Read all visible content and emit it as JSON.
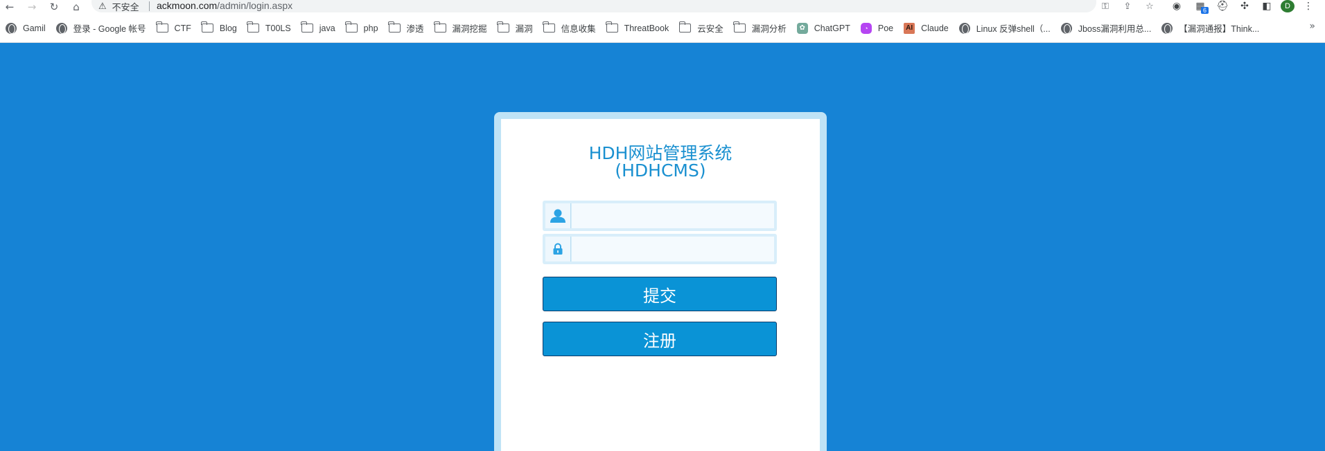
{
  "browser": {
    "security_label": "不安全",
    "url_host": "ackmoon.com",
    "url_path": "/admin/login.aspx",
    "extension_badge": "6",
    "profile_initial": "D",
    "icons": [
      "back-icon",
      "forward-icon",
      "reload-icon",
      "home-icon",
      "warning-icon",
      "key-icon",
      "share-icon",
      "star-icon"
    ]
  },
  "bookmarks": [
    {
      "label": "Gamil",
      "icon": "globe"
    },
    {
      "label": "登录 - Google 帐号",
      "icon": "globe"
    },
    {
      "label": "CTF",
      "icon": "folder"
    },
    {
      "label": "Blog",
      "icon": "folder"
    },
    {
      "label": "T00LS",
      "icon": "folder"
    },
    {
      "label": "java",
      "icon": "folder"
    },
    {
      "label": "php",
      "icon": "folder"
    },
    {
      "label": "渗透",
      "icon": "folder"
    },
    {
      "label": "漏洞挖掘",
      "icon": "folder"
    },
    {
      "label": "漏洞",
      "icon": "folder"
    },
    {
      "label": "信息收集",
      "icon": "folder"
    },
    {
      "label": "ThreatBook",
      "icon": "folder"
    },
    {
      "label": "云安全",
      "icon": "folder"
    },
    {
      "label": "漏洞分析",
      "icon": "folder"
    },
    {
      "label": "ChatGPT",
      "icon": "chatgpt"
    },
    {
      "label": "Poe",
      "icon": "poe"
    },
    {
      "label": "Claude",
      "icon": "claude"
    },
    {
      "label": "Linux 反弹shell（...",
      "icon": "globe"
    },
    {
      "label": "Jboss漏洞利用总...",
      "icon": "globe"
    },
    {
      "label": "【漏洞通报】Think...",
      "icon": "globe"
    }
  ],
  "login": {
    "title_line1": "HDH网站管理系统",
    "title_line2": "(HDHCMS)",
    "username_value": "",
    "password_value": "",
    "submit_label": "提交",
    "register_label": "注册"
  },
  "colors": {
    "background": "#1683d5",
    "title": "#1a90d0",
    "button": "#0a93d6"
  }
}
